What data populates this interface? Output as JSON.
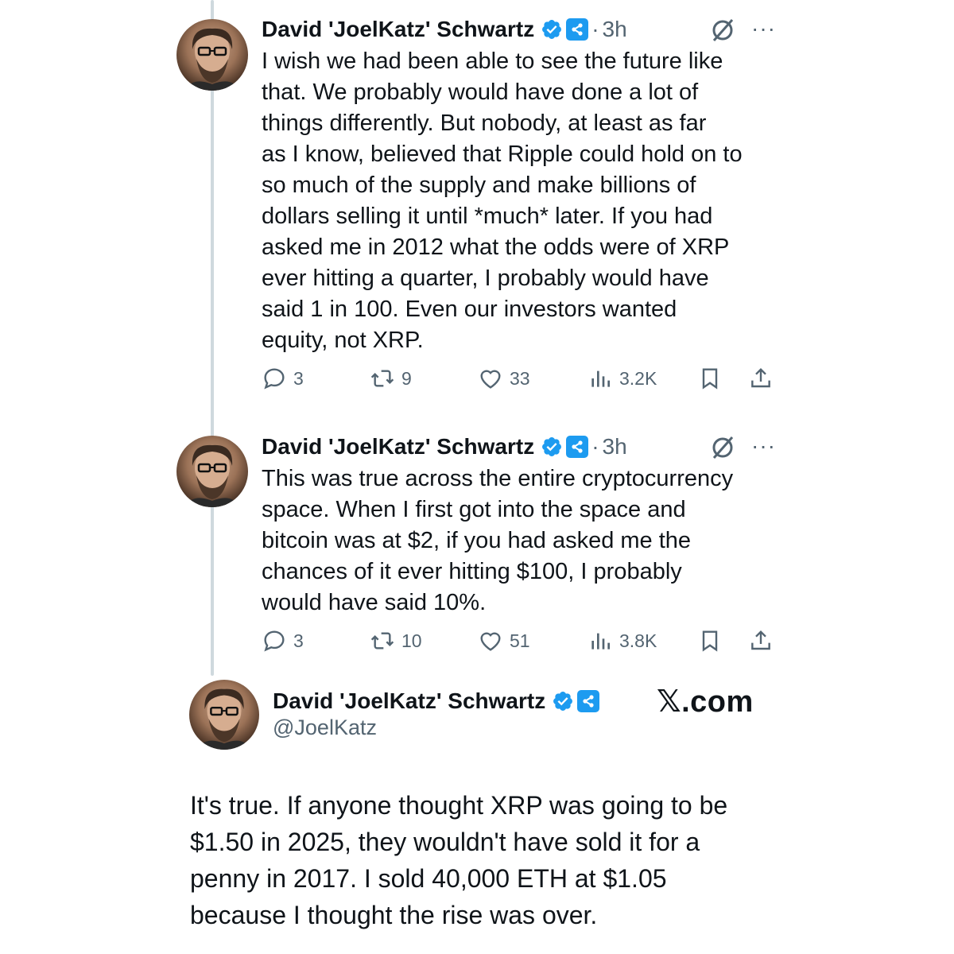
{
  "tweets": [
    {
      "author": "David 'JoelKatz' Schwartz",
      "dot": "·",
      "time": "3h",
      "more": "···",
      "text": "I wish we had been able to see the future like\nthat. We probably would have done a lot of\nthings differently. But nobody, at least as far\nas I know, believed that Ripple could hold on to\nso much of the supply and make billions of\ndollars selling it until *much* later. If you had\nasked me in 2012 what the odds were of XRP\never hitting a quarter, I probably would have\nsaid 1 in 100. Even our investors wanted\nequity, not XRP.",
      "replies": "3",
      "reposts": "9",
      "likes": "33",
      "views": "3.2K"
    },
    {
      "author": "David 'JoelKatz' Schwartz",
      "dot": "·",
      "time": "3h",
      "more": "···",
      "text": "This was true across the entire cryptocurrency\nspace. When I first got into the space and\nbitcoin was at $2, if you had asked me the\nchances of it ever hitting $100, I probably\nwould have said 10%.",
      "replies": "3",
      "reposts": "10",
      "likes": "51",
      "views": "3.8K"
    }
  ],
  "quote": {
    "author": "David 'JoelKatz' Schwartz",
    "handle": "@JoelKatz",
    "brand": "𝕏.com",
    "text": "It's true. If anyone thought XRP was going to be\n$1.50 in 2025, they wouldn't have sold it for a\npenny in 2017. I sold 40,000 ETH at $1.05\nbecause I thought the rise was over."
  },
  "icons": {
    "verified": "verified-badge-icon",
    "affiliate": "ripple-affiliate-icon",
    "grok": "grok-icon",
    "more": "more-icon",
    "reply": "reply-icon",
    "repost": "repost-icon",
    "like": "like-icon",
    "views": "views-icon",
    "bookmark": "bookmark-icon",
    "share": "share-icon"
  },
  "colors": {
    "verified_blue": "#1d9bf0",
    "muted_text": "#536471",
    "thread_line": "#cfd9de"
  }
}
